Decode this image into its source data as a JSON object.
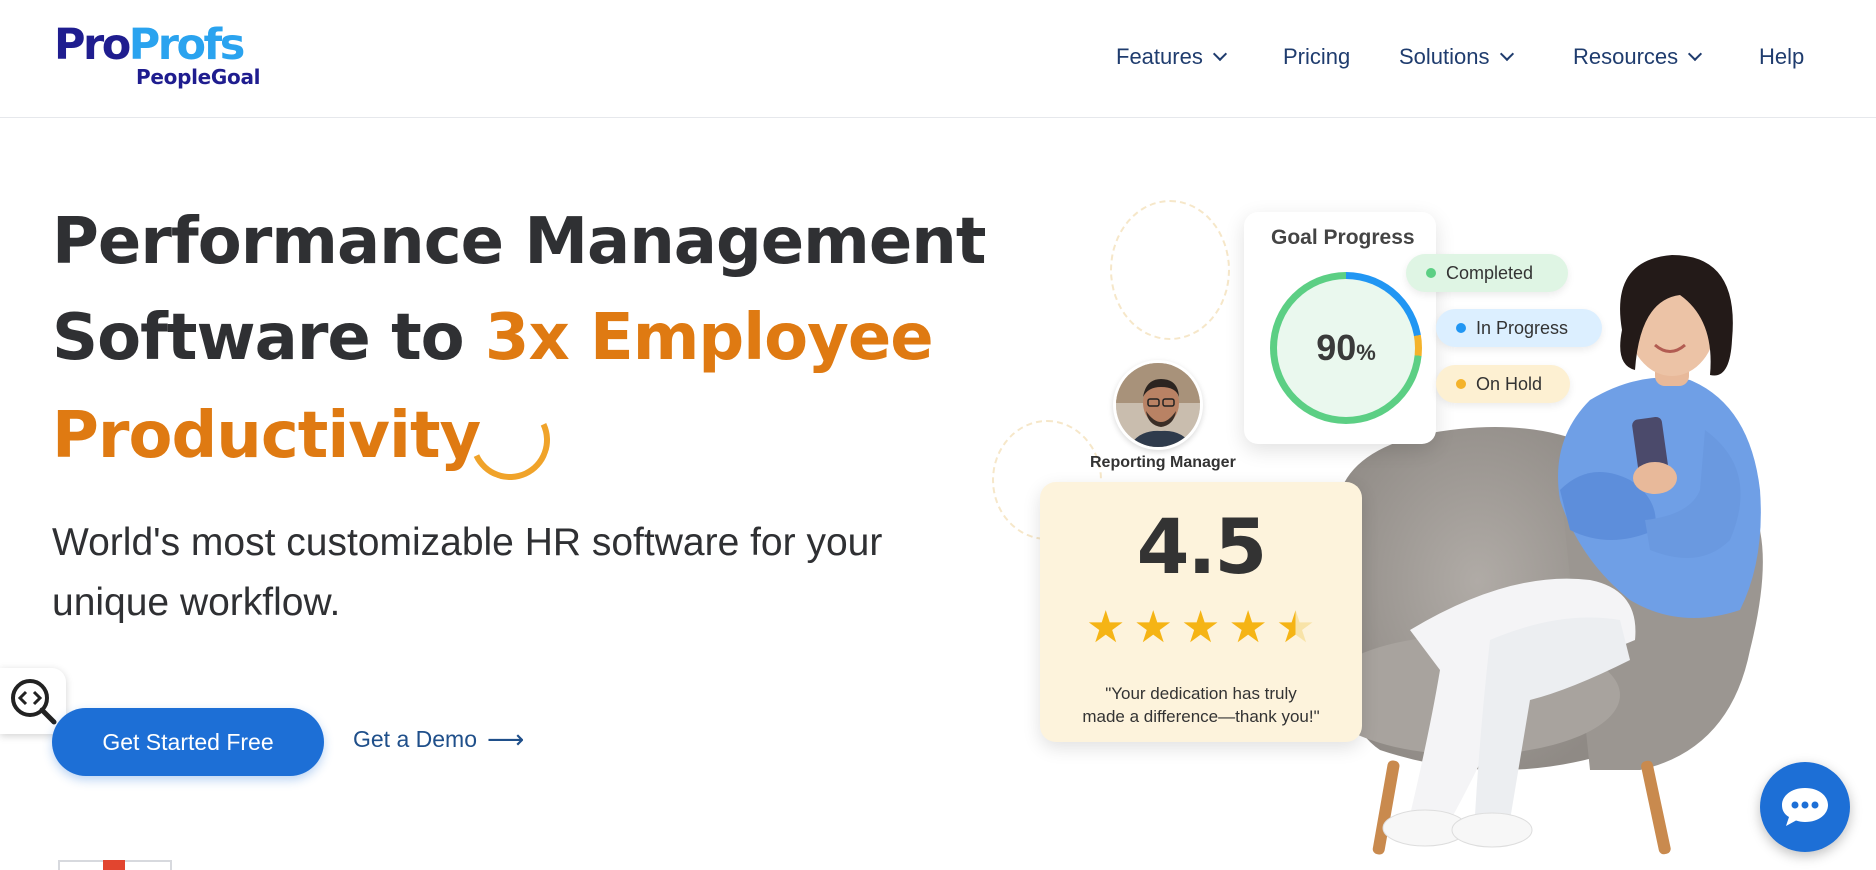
{
  "header": {
    "logo": {
      "brand_part1": "Pro",
      "brand_part2": "Profs",
      "sub": "PeopleGoal"
    },
    "nav": [
      {
        "label": "Features",
        "has_dropdown": true
      },
      {
        "label": "Pricing",
        "has_dropdown": false
      },
      {
        "label": "Solutions",
        "has_dropdown": true
      },
      {
        "label": "Resources",
        "has_dropdown": true
      },
      {
        "label": "Help",
        "has_dropdown": false
      }
    ]
  },
  "hero": {
    "line1": "Performance Management",
    "line2_plain": "Software to ",
    "line2_accent": "3x Employee",
    "line3_accent": "Productivity",
    "subheadline_line1": "World's most customizable HR software for your",
    "subheadline_line2": "unique workflow.",
    "cta_primary": "Get Started Free",
    "cta_secondary": "Get a Demo",
    "cta_secondary_arrow": "⟶"
  },
  "illustration": {
    "goal_card": {
      "title": "Goal Progress",
      "progress_value": "90",
      "progress_unit": "%",
      "legend": [
        {
          "label": "Completed",
          "color": "#5ccf84",
          "bg": "#dff5e4"
        },
        {
          "label": "In Progress",
          "color": "#2196f3",
          "bg": "#dcefff"
        },
        {
          "label": "On Hold",
          "color": "#f4b32b",
          "bg": "#fdf0d2"
        }
      ]
    },
    "reporting_manager_label": "Reporting Manager",
    "rating_card": {
      "value": "4.5",
      "stars": 4.5,
      "quote_line1": "\"Your dedication has truly",
      "quote_line2": "made a difference—thank you!\""
    }
  },
  "colors": {
    "accent_orange": "#df7a12",
    "primary_blue": "#1d6fd6",
    "nav_text": "#1f3c6e",
    "heading_text": "#2f3033"
  },
  "icons": {
    "search_tab": "search-code-icon",
    "chat": "chat-bubble-icon"
  }
}
